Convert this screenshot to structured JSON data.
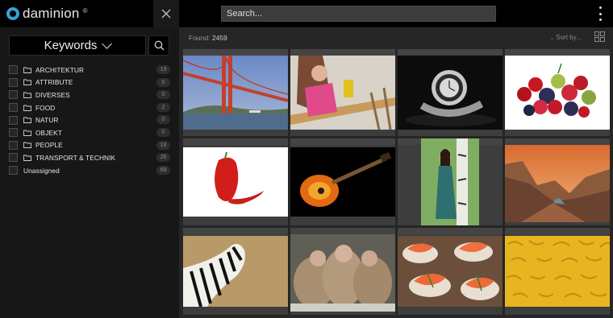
{
  "app": {
    "name": "daminion",
    "trademark": "®"
  },
  "search": {
    "placeholder": "Search..."
  },
  "sidebar": {
    "panel_title": "Keywords",
    "keywords": [
      {
        "label": "ARCHITEKTUR",
        "count": "19",
        "folder": true
      },
      {
        "label": "ATTRIBUTE",
        "count": "0",
        "folder": true
      },
      {
        "label": "DIVERSES",
        "count": "0",
        "folder": true
      },
      {
        "label": "FOOD",
        "count": "2",
        "folder": true
      },
      {
        "label": "NATUR",
        "count": "0",
        "folder": true
      },
      {
        "label": "OBJEKT",
        "count": "0",
        "folder": true
      },
      {
        "label": "PEOPLE",
        "count": "18",
        "folder": true
      },
      {
        "label": "TRANSPORT & TECHNIK",
        "count": "26",
        "folder": true
      },
      {
        "label": "Unassigned",
        "count": "68",
        "folder": false
      }
    ]
  },
  "main": {
    "found_label": "Found:",
    "found_count": "2459",
    "sort_label": "Sort by..."
  },
  "thumbnails": [
    {
      "subject": "golden-gate-bridge"
    },
    {
      "subject": "woman-drilling-wood"
    },
    {
      "subject": "wristwatch"
    },
    {
      "subject": "berries"
    },
    {
      "subject": "red-pepper"
    },
    {
      "subject": "electric-guitar"
    },
    {
      "subject": "woman-by-birch-tree"
    },
    {
      "subject": "canyon-landscape"
    },
    {
      "subject": "zebra"
    },
    {
      "subject": "monkeys"
    },
    {
      "subject": "salmon-canapes"
    },
    {
      "subject": "fusilli-pasta"
    }
  ],
  "colors": {
    "accent": "#3a9fd8",
    "background": "#262626",
    "sidebar": "#171717",
    "topbar": "#000000"
  }
}
